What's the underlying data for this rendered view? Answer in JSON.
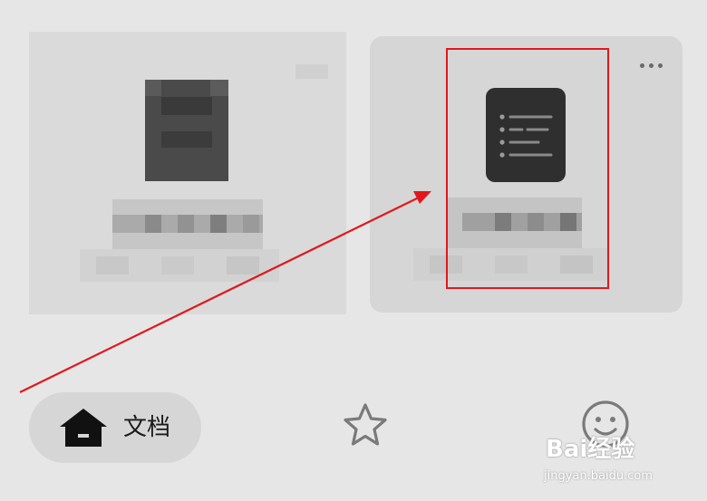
{
  "nav": {
    "docs_label": "文档",
    "home_icon": "home-icon",
    "star_icon": "star-icon",
    "emoji_icon": "smile-icon"
  },
  "cards": [
    {
      "icon": "doc-icon-blurred",
      "title": "",
      "subtitle": ""
    },
    {
      "icon": "doc-list-icon",
      "title": "",
      "subtitle": "",
      "menu_icon": "more-icon"
    }
  ],
  "annotation": {
    "box_color": "#e0181e",
    "arrow_color": "#e0181e"
  },
  "watermark": {
    "brand": "Bai经验",
    "url": "jingyan.baidu.com"
  }
}
